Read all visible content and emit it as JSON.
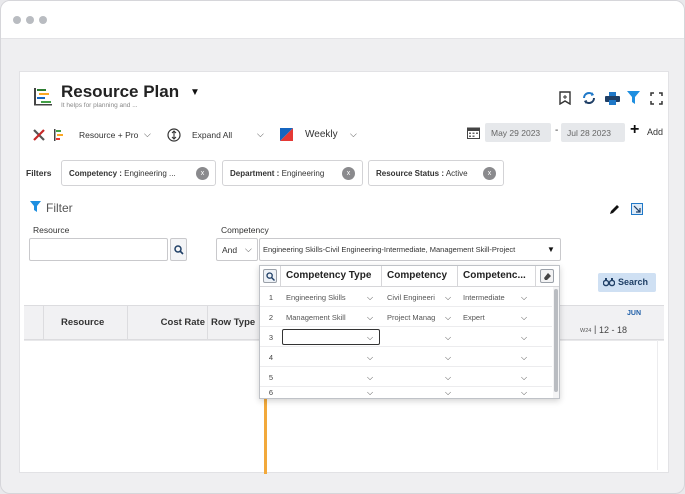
{
  "header": {
    "title": "Resource Plan",
    "subtitle": "It helps for planning and ..."
  },
  "toolbar": {
    "view_select": "Resource + Pro",
    "expand_select": "Expand All",
    "period_select": "Weekly",
    "start_date": "May 29 2023",
    "date_separator": "-",
    "end_date": "Jul 28 2023",
    "add_label": "Add"
  },
  "filters": {
    "label": "Filters",
    "chips": [
      {
        "key": "Competency :",
        "value": " Engineering ..."
      },
      {
        "key": "Department :",
        "value": " Engineering"
      },
      {
        "key": "Resource Status :",
        "value": " Active"
      }
    ],
    "chip_close": "x"
  },
  "filter_panel": {
    "title": "Filter",
    "resource_label": "Resource",
    "resource_value": "",
    "competency_label": "Competency",
    "operator": "And",
    "competency_value": "Engineering Skills-Civil Engineering-Intermediate, Management Skill-Project"
  },
  "competency_dropdown": {
    "headers": [
      "Competency Type",
      "Competency",
      "Competenc..."
    ],
    "rows": [
      {
        "num": "1",
        "type": "Engineering Skills",
        "competency": "Civil Engineeri",
        "level": "Intermediate"
      },
      {
        "num": "2",
        "type": "Management Skill",
        "competency": "Project Manag",
        "level": "Expert"
      },
      {
        "num": "3",
        "type": "",
        "competency": "",
        "level": ""
      },
      {
        "num": "4",
        "type": "",
        "competency": "",
        "level": ""
      },
      {
        "num": "5",
        "type": "",
        "competency": "",
        "level": ""
      },
      {
        "num": "6",
        "type": "",
        "competency": "",
        "level": ""
      }
    ]
  },
  "search_button": "Search",
  "grid": {
    "columns": [
      "Resource",
      "Cost Rate",
      "Row Type"
    ],
    "timeline_month": "JUN",
    "timeline_week_num": "W24",
    "timeline_week_range": "12 - 18"
  },
  "colors": {
    "accent_blue": "#1f78c8",
    "timeline_marker": "#f2a93b",
    "search_bg": "#cfe0f3"
  }
}
